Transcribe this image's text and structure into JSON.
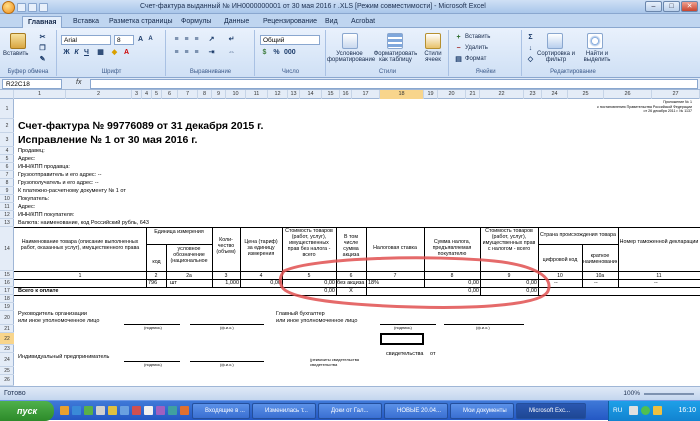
{
  "window": {
    "title": "Счет-фактура выданный № ИН0000000001 от 30 мая 2016 г .XLS  [Режим совместимости] - Microsoft Excel"
  },
  "tabs": [
    "Главная",
    "Вставка",
    "Разметка страницы",
    "Формулы",
    "Данные",
    "Рецензирование",
    "Вид",
    "Acrobat"
  ],
  "ribbon": {
    "paste": "Вставить",
    "font_name": "Arial",
    "font_size": "8",
    "number_format": "Общий",
    "cond_format": "Условное форматирование",
    "table_format": "Форматировать как таблицу",
    "cell_styles": "Стили ячеек",
    "insert": "Вставить",
    "delete": "Удалить",
    "format": "Формат",
    "sort": "Сортировка и фильтр",
    "find": "Найти и выделить",
    "groups": [
      "Буфер обмена",
      "Шрифт",
      "Выравнивание",
      "Число",
      "Стили",
      "Ячейки",
      "Редактирование"
    ]
  },
  "formula_bar": {
    "name_box": "R22C18",
    "fx": "fx",
    "value": ""
  },
  "columns": [
    "1",
    "2",
    "3",
    "4",
    "5",
    "6",
    "7",
    "8",
    "9",
    "10",
    "11",
    "12",
    "13",
    "14",
    "15",
    "16",
    "17",
    "18",
    "19",
    "20",
    "21",
    "22",
    "23",
    "24",
    "25",
    "26",
    "27"
  ],
  "rows": [
    "1",
    "2",
    "3",
    "4",
    "5",
    "6",
    "7",
    "8",
    "9",
    "10",
    "11",
    "12",
    "13",
    "14",
    "15",
    "16",
    "17",
    "18",
    "19",
    "20",
    "21",
    "22",
    "23",
    "24",
    "25",
    "26"
  ],
  "doc": {
    "note": "Приложение № 1\nк постановлению Правительства Российской Федерации\nот 26 декабря 2011 г. № 1137",
    "title": "Счет-фактура № 99776089 от 31 декабря 2015 г.",
    "correction": "Исправление № 1 от 30 мая 2016 г.",
    "seller": "Продавец:",
    "address1": "Адрес:",
    "inn_seller": "ИНН/КПП продавца:",
    "shipper": "Грузоотправитель и его адрес: --",
    "consignee": "Грузополучатель и его адрес: --",
    "payment_doc": "К платежно-расчетному документу № 1 от",
    "buyer": "Покупатель:",
    "address2": "Адрес:",
    "inn_buyer": "ИНН/КПП покупателя:",
    "currency": "Валюта: наименование, код Российский рубль, 643",
    "headers": {
      "name": "Наименование товара (описание выполненных работ, оказанных услуг), имущественного права",
      "unit": "Единица измерения",
      "code": "код",
      "unit_short": "условное обозначение (национальное",
      "qty": "Коли-чество (объем)",
      "price": "Цена (тариф) за единицу измерения",
      "cost_no_tax": "Стоимость товаров (работ, услуг), имущественных прав без налога - всего",
      "excise": "В том числе сумма акциза",
      "tax_rate": "Налоговая ставка",
      "tax_amount": "Сумма налога, предъявляемая покупателю",
      "cost_with_tax": "Стоимость товаров (работ, услуг), имущественных прав с налогом - всего",
      "country": "Страна происхождения товара",
      "digit_code": "цифровой код",
      "short_name": "краткое наименование",
      "customs": "Номер таможенной декларации"
    },
    "col_numbers": [
      "1",
      "2",
      "2а",
      "3",
      "4",
      "5",
      "6",
      "7",
      "8",
      "9",
      "10",
      "10а",
      "11"
    ],
    "row17": {
      "code": "796",
      "unit": "шт",
      "qty": "1,000",
      "price": "0,00",
      "cost": "0,00",
      "excise": "без акциза",
      "rate": "18%",
      "tax": "0,00",
      "total": "0,00",
      "dash1": "--",
      "dash2": "--",
      "dash3": "--"
    },
    "row18": {
      "label": "Всего к оплате",
      "cost": "0,00",
      "excise": "Х",
      "tax": "0,00",
      "total": "0,00"
    },
    "sign_head": "Руководитель организации\nили иное уполномоченное лицо",
    "sign_chief_acc": "Главный бухгалтер\nили иное уполномоченное лицо",
    "sign_ip": "Индивидуальный предприниматель",
    "podpis": "(подпись)",
    "fio": "(ф.и.о.)",
    "requisites": "(реквизиты свидетельства",
    "certificate": "свидетельства",
    "ot": "от"
  },
  "status": {
    "text": "Готово",
    "zoom": "100%"
  },
  "taskbar": {
    "start": "пуск",
    "items": [
      "Входящие в ...",
      "Изменилась т...",
      "Доки от Гал...",
      "НОВЫЕ 20.04...",
      "Мои документы",
      "Microsoft Exc..."
    ],
    "lang": "RU",
    "time": "16:10"
  },
  "colors": {
    "annotation": "#e05050",
    "highlight": "#f8d58c"
  }
}
